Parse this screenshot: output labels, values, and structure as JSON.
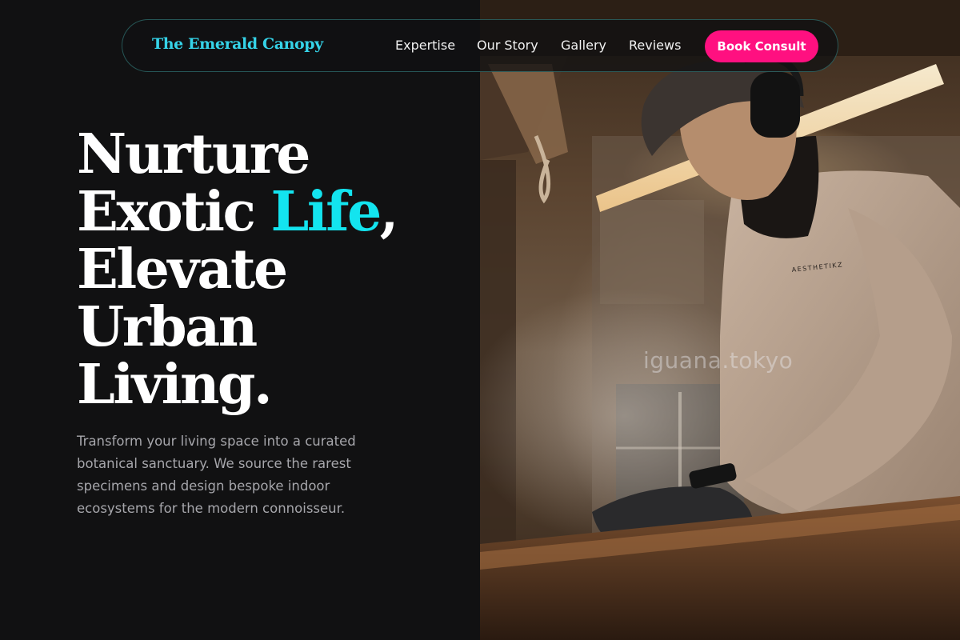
{
  "nav": {
    "brand": "The Emerald Canopy",
    "links": [
      "Expertise",
      "Our Story",
      "Gallery",
      "Reviews"
    ],
    "cta": "Book Consult"
  },
  "hero": {
    "headline": {
      "line1": "Nurture",
      "line2_prefix": "Exotic ",
      "line2_accent": "Life",
      "line2_suffix": ",",
      "line3": "Elevate",
      "line4": "Urban",
      "line5": "Living."
    },
    "description": "Transform your living space into a curated botanical sanctuary. We source the rarest specimens and design bespoke indoor ecosystems for the modern connoisseur.",
    "image": {
      "subject": "craftsman in cap and headphones working at a bench in a dusty workshop",
      "watermark": "iguana.tokyo",
      "shirt_text": "AESTHETIKZ"
    }
  },
  "colors": {
    "background": "#111112",
    "accent_cyan": "#13e4ef",
    "brand_cyan": "#35d3e8",
    "cta_pink": "#ff1080",
    "body_text": "#a6a6ab"
  }
}
